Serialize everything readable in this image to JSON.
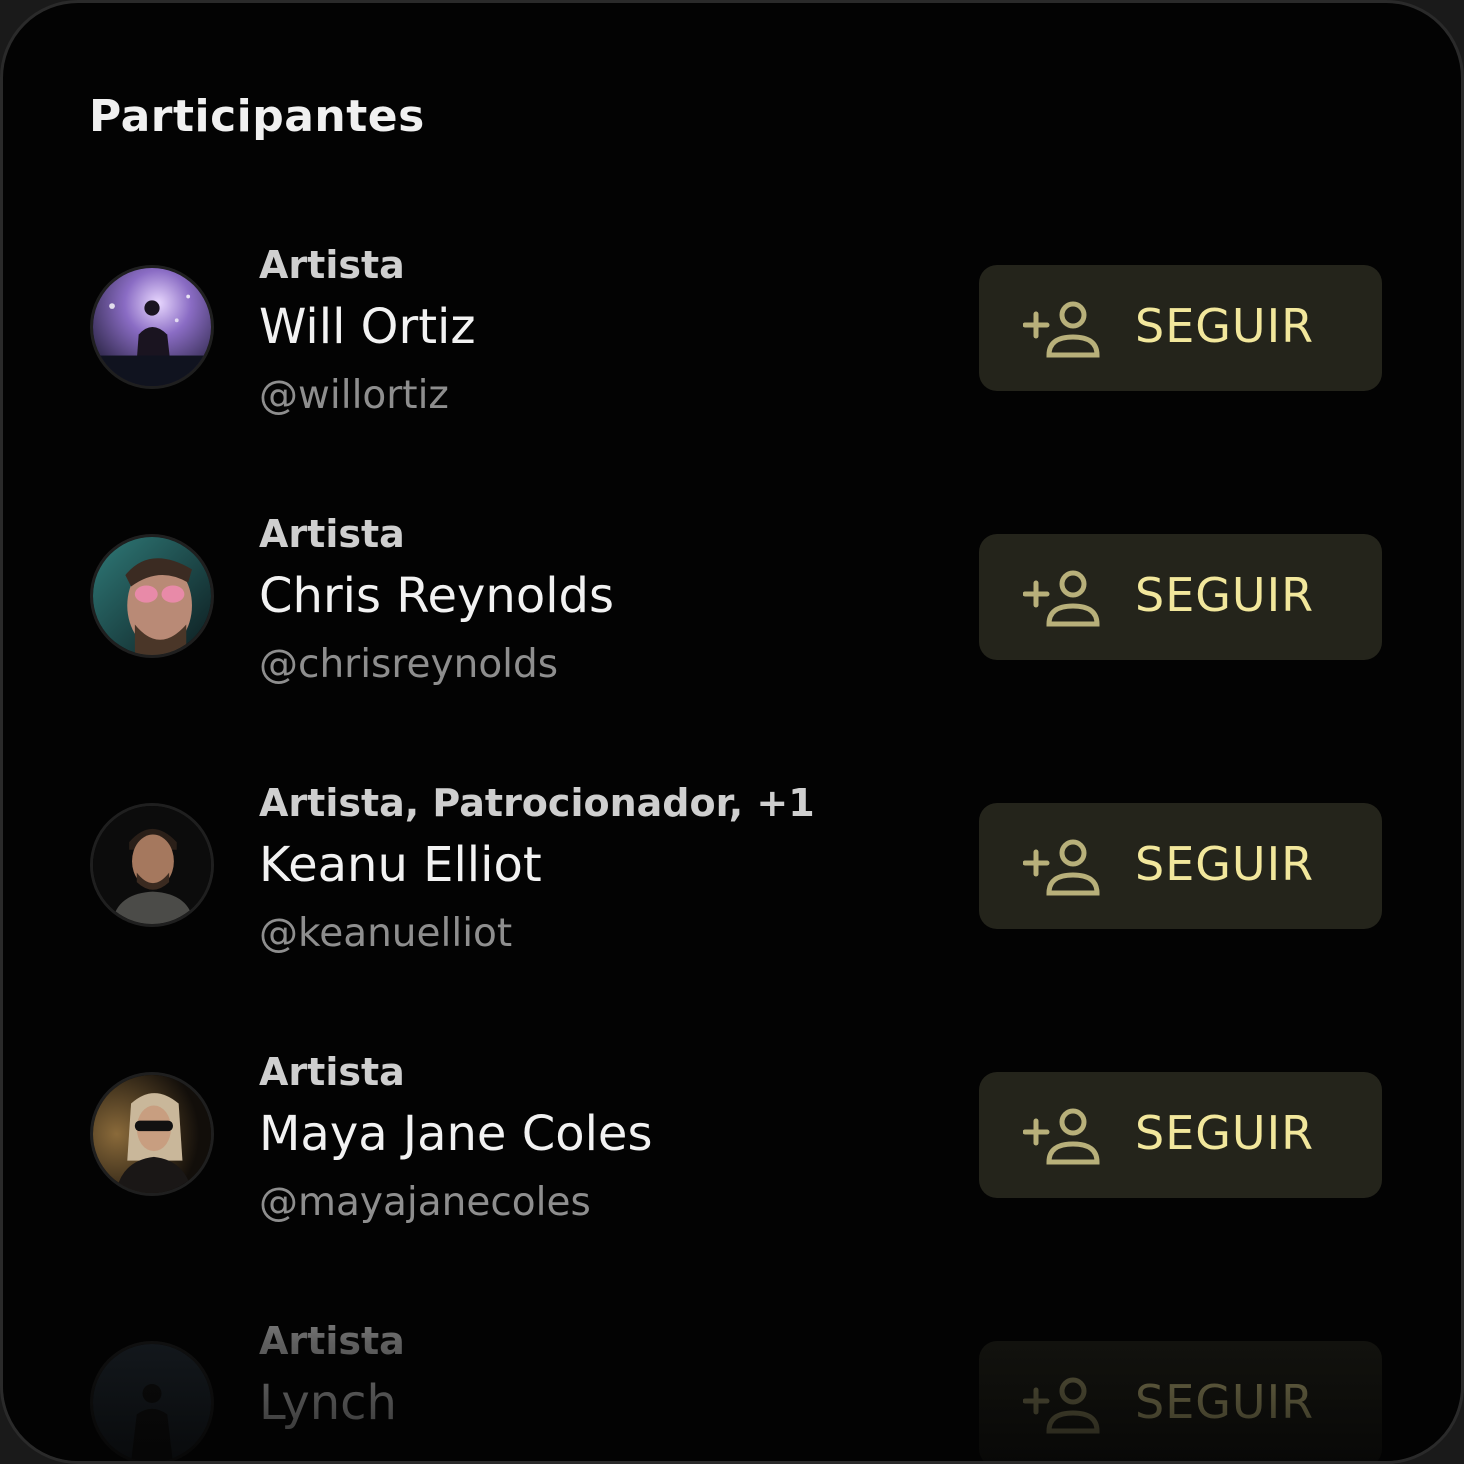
{
  "header": {
    "title": "Participantes"
  },
  "participants": [
    {
      "role": "Artista",
      "name": "Will Ortiz",
      "handle": "@willortiz",
      "follow_label": "SEGUIR"
    },
    {
      "role": "Artista",
      "name": "Chris Reynolds",
      "handle": "@chrisreynolds",
      "follow_label": "SEGUIR"
    },
    {
      "role": "Artista, Patrocionador, +1",
      "name": "Keanu Elliot",
      "handle": "@keanuelliot",
      "follow_label": "SEGUIR"
    },
    {
      "role": "Artista",
      "name": "Maya Jane Coles",
      "handle": "@mayajanecoles",
      "follow_label": "SEGUIR"
    },
    {
      "role": "Artista",
      "name": "Lynch",
      "handle": "",
      "follow_label": "SEGUIR"
    }
  ],
  "colors": {
    "background": "#030303",
    "button_bg": "#24241b",
    "accent": "#f2e79c",
    "icon": "#b8b07a"
  },
  "icons": {
    "follow": "person-add-icon"
  }
}
